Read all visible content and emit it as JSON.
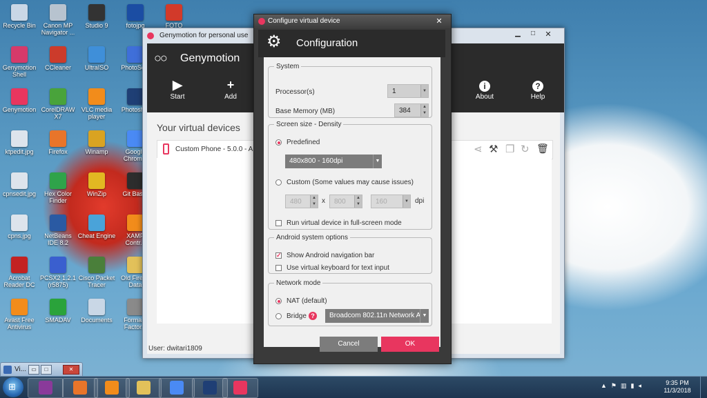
{
  "desktop": {
    "icons": [
      {
        "label": "Recycle Bin",
        "color": "#c9d7e6"
      },
      {
        "label": "Canon MP Navigator ...",
        "color": "#b7c3cf"
      },
      {
        "label": "Studio 9",
        "color": "#333333"
      },
      {
        "label": "fotojpg",
        "color": "#1b4da3"
      },
      {
        "label": "FOTO",
        "color": "#d23a2a"
      },
      {
        "label": "Genymotion Shell",
        "color": "#d63a6a"
      },
      {
        "label": "CCleaner",
        "color": "#cc3b2b"
      },
      {
        "label": "UltraISO",
        "color": "#3f8fd9"
      },
      {
        "label": "PhotoSc...",
        "color": "#3f6fd9"
      },
      {
        "label": "Genymotion",
        "color": "#e8365f"
      },
      {
        "label": "CorelDRAW X7",
        "color": "#49a33b"
      },
      {
        "label": "VLC media player",
        "color": "#f28c1b"
      },
      {
        "label": "Photosh...",
        "color": "#1f3f75"
      },
      {
        "label": "ktpedit.jpg",
        "color": "#dde4ec"
      },
      {
        "label": "Firefox",
        "color": "#e8752a"
      },
      {
        "label": "Winamp",
        "color": "#d9a322"
      },
      {
        "label": "Google Chrom...",
        "color": "#4a8af4"
      },
      {
        "label": "cpnsedit.jpg",
        "color": "#dde4ec"
      },
      {
        "label": "Hex Color Finder",
        "color": "#2fa34a"
      },
      {
        "label": "WinZip",
        "color": "#e2b822"
      },
      {
        "label": "Git Bas...",
        "color": "#2d2d2d"
      },
      {
        "label": "cpns.jpg",
        "color": "#dde4ec"
      },
      {
        "label": "NetBeans IDE 8.2",
        "color": "#2a5aa3"
      },
      {
        "label": "Cheat Engine",
        "color": "#4aa3d9"
      },
      {
        "label": "XAMP Contr...",
        "color": "#f28c1b"
      },
      {
        "label": "Acrobat Reader DC",
        "color": "#c32222"
      },
      {
        "label": "PCSX2 1.2.1 (r5875)",
        "color": "#3a5fcf"
      },
      {
        "label": "Cisco Packet Tracer",
        "color": "#4a7f3a"
      },
      {
        "label": "Old Firef... Data",
        "color": "#e2c15a"
      },
      {
        "label": "Avast Free Antivirus",
        "color": "#f28c1b"
      },
      {
        "label": "SMADAV",
        "color": "#2aa33b"
      },
      {
        "label": "Documents",
        "color": "#c9d7e6"
      },
      {
        "label": "Forma... Factor...",
        "color": "#8a8a8a"
      }
    ]
  },
  "minimized_window": {
    "label": "Vi..."
  },
  "main_window": {
    "title": "Genymotion for personal use",
    "brand": "Genymotion",
    "toolbar": [
      {
        "label": "Start",
        "icon": "play-icon",
        "sym": "▶"
      },
      {
        "label": "Add",
        "icon": "plus-icon",
        "sym": "+"
      },
      {
        "label": "About",
        "icon": "info-icon",
        "sym": "i"
      },
      {
        "label": "Help",
        "icon": "help-icon",
        "sym": "?"
      }
    ],
    "section_title": "Your virtual devices",
    "device_name": "Custom Phone - 5.0.0 - API",
    "user_status": "User: dwitari1809"
  },
  "dialog": {
    "window_title": "Configure virtual device",
    "header": "Configuration",
    "system": {
      "legend": "System",
      "processors_label": "Processor(s)",
      "processors_value": "1",
      "memory_label": "Base Memory (MB)",
      "memory_value": "384"
    },
    "screen": {
      "legend": "Screen size - Density",
      "predefined_label": "Predefined",
      "predefined_value": "480x800 - 160dpi",
      "custom_label": "Custom (Some values may cause issues)",
      "width_value": "480",
      "x_sep": "x",
      "height_value": "800",
      "dpi_value": "160",
      "dpi_label": "dpi",
      "fullscreen_label": "Run virtual device in full-screen mode"
    },
    "android": {
      "legend": "Android system options",
      "navbar_label": "Show Android navigation bar",
      "keyboard_label": "Use virtual keyboard for text input"
    },
    "network": {
      "legend": "Network mode",
      "nat_label": "NAT (default)",
      "bridge_label": "Bridge",
      "bridge_value": "Broadcom 802.11n Network A"
    },
    "cancel_label": "Cancel",
    "ok_label": "OK"
  },
  "taskbar": {
    "apps": [
      {
        "name": "winrar",
        "color": "#8a3a9a"
      },
      {
        "name": "firefox",
        "color": "#e8752a"
      },
      {
        "name": "vlc",
        "color": "#f28c1b"
      },
      {
        "name": "explorer",
        "color": "#e2c15a"
      },
      {
        "name": "chrome",
        "color": "#4a8af4"
      },
      {
        "name": "photoshop",
        "color": "#1f3f75"
      },
      {
        "name": "genymotion",
        "color": "#e8365f"
      }
    ],
    "time": "9:35 PM",
    "date": "11/3/2018"
  },
  "colors": {
    "accent": "#e8365f",
    "dark": "#2b2b2b"
  }
}
